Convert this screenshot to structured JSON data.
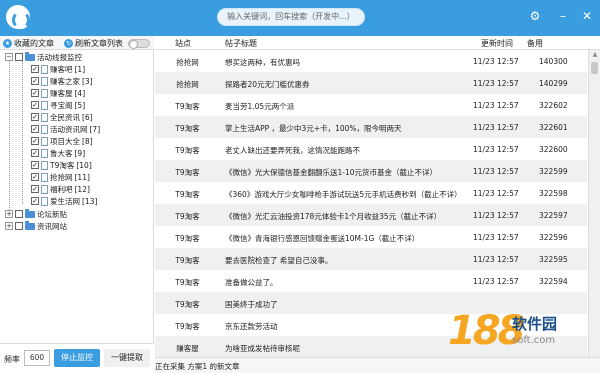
{
  "search": {
    "placeholder": "输入关键词，回车搜索（开发中...）"
  },
  "toolbar": {
    "collect_label": "收藏的文章",
    "refresh_label": "刷新文章列表"
  },
  "tree": {
    "groups": [
      {
        "label": "活动线报监控",
        "expanded": true,
        "items": [
          {
            "label": "赚客吧",
            "count": "[1]",
            "checked": true
          },
          {
            "label": "赚客之家",
            "count": "[3]",
            "checked": true
          },
          {
            "label": "赚客屋",
            "count": "[4]",
            "checked": true
          },
          {
            "label": "寻宝阁",
            "count": "[5]",
            "checked": true
          },
          {
            "label": "全民资讯",
            "count": "[6]",
            "checked": true
          },
          {
            "label": "活动资讯网",
            "count": "[7]",
            "checked": true
          },
          {
            "label": "项目大全",
            "count": "[8]",
            "checked": true
          },
          {
            "label": "鲁大客",
            "count": "[9]",
            "checked": true
          },
          {
            "label": "T9淘客",
            "count": "[10]",
            "checked": true
          },
          {
            "label": "抢抢网",
            "count": "[11]",
            "checked": true
          },
          {
            "label": "福利吧",
            "count": "[12]",
            "checked": true
          },
          {
            "label": "爱生活网",
            "count": "[13]",
            "checked": true
          }
        ]
      },
      {
        "label": "论坛新贴",
        "expanded": false
      },
      {
        "label": "资讯网站",
        "expanded": false
      }
    ]
  },
  "table": {
    "columns": [
      "站点",
      "帖子标题",
      "更新时间",
      "备用"
    ],
    "rows": [
      {
        "site": "抢抢网",
        "title": "想买这两种，有优惠吗",
        "time": "11/23 12:57",
        "id": "140300"
      },
      {
        "site": "抢抢网",
        "title": "探路者20元无门槛优惠券",
        "time": "11/23 12:57",
        "id": "140299"
      },
      {
        "site": "T9淘客",
        "title": "麦当劳1.05元两个派",
        "time": "11/23 12:57",
        "id": "322602"
      },
      {
        "site": "T9淘客",
        "title": "掌上生活APP ，最少中3元+卡，100%，限今明两天",
        "time": "11/23 12:57",
        "id": "322601"
      },
      {
        "site": "T9淘客",
        "title": "老丈人缺出还要弄死我，这情况能跑路不",
        "time": "11/23 12:57",
        "id": "322600"
      },
      {
        "site": "T9淘客",
        "title": "《微信》光大保德信基金翻翻乐送1-10元货币基金（截止不详）",
        "time": "11/23 12:57",
        "id": "322599"
      },
      {
        "site": "T9淘客",
        "title": "《360》游戏大厅少女咖啡枪手游试玩送5元手机话费秒到（截止不详）",
        "time": "11/23 12:57",
        "id": "322598"
      },
      {
        "site": "T9淘客",
        "title": "《微信》光汇云油投资178元体验卡1个月收益35元（截止不详）",
        "time": "11/23 12:57",
        "id": "322597"
      },
      {
        "site": "T9淘客",
        "title": "《微信》青海银行感恩回馈赠金蛋送10M-1G（截止不详）",
        "time": "11/23 12:57",
        "id": "322596"
      },
      {
        "site": "T9淘客",
        "title": "要去医院检查了 希望自己没事。",
        "time": "11/23 12:57",
        "id": "322595"
      },
      {
        "site": "T9淘客",
        "title": "准备做公益了。",
        "time": "11/23 12:57",
        "id": "322594"
      },
      {
        "site": "T9淘客",
        "title": "国美终于成功了",
        "time": "",
        "id": ""
      },
      {
        "site": "T9淘客",
        "title": "京东还款劳活动",
        "time": "",
        "id": ""
      },
      {
        "site": "赚客屋",
        "title": "为啥亚成发帖待审核呢",
        "time": "",
        "id": ""
      }
    ]
  },
  "bottom": {
    "freq_label": "频率",
    "freq_value": "600",
    "stop_label": "停止监控",
    "extract_label": "一键提取"
  },
  "status": {
    "text": "正在采集 方案1 的新文章"
  },
  "watermark": {
    "digits": "188",
    "name": "软件园",
    "url": "soft.com"
  },
  "colors": {
    "accent": "#3a9de0",
    "row_alt": "#eef0f2"
  },
  "icons": {
    "app": "app-logo-icon",
    "settings": "gear-icon",
    "minimize": "minimize-icon",
    "close": "close-icon"
  }
}
